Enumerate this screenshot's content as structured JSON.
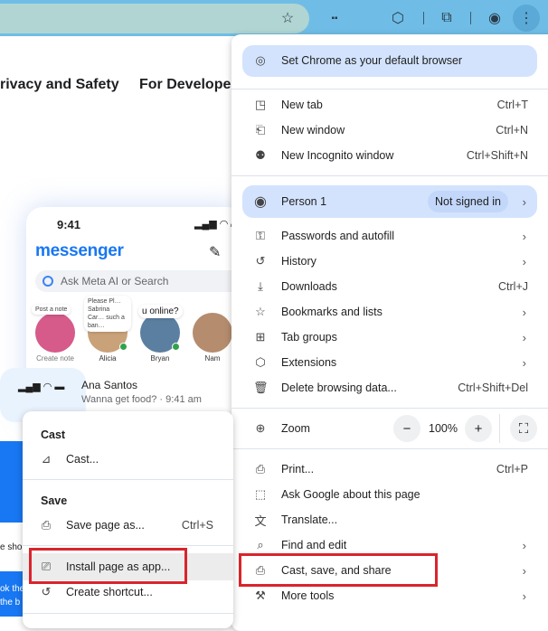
{
  "toolbar": {
    "icons": [
      "star-icon",
      "tab-search-icon",
      "extensions-icon",
      "reading-list-icon",
      "profile-icon",
      "more-icon"
    ]
  },
  "page": {
    "nav": [
      "rivacy and Safety",
      "For Developer"
    ],
    "phone": {
      "time": "9:41",
      "logo": "messenger",
      "search_placeholder": "Ask Meta AI or Search",
      "notes": [
        "Post a note",
        "Please Pl… Sabrina Car… such a ban…",
        "u online?"
      ],
      "contacts": [
        "Create note",
        "Alicia",
        "Bryan",
        "Nam"
      ],
      "chat_name": "Ana Santos",
      "chat_preview": "Wanna get food? · 9:41 am"
    },
    "fragments": [
      "e sho",
      "ok the",
      "the b"
    ]
  },
  "menu": {
    "default_browser": "Set Chrome as your default browser",
    "items_a": [
      {
        "label": "New tab",
        "shortcut": "Ctrl+T",
        "icon": "◳"
      },
      {
        "label": "New window",
        "shortcut": "Ctrl+N",
        "icon": "⎗"
      },
      {
        "label": "New Incognito window",
        "shortcut": "Ctrl+Shift+N",
        "icon": "⚉"
      }
    ],
    "person": {
      "label": "Person 1",
      "status": "Not signed in"
    },
    "items_b": [
      {
        "label": "Passwords and autofill",
        "shortcut": "",
        "icon": "⚿",
        "arrow": true
      },
      {
        "label": "History",
        "shortcut": "",
        "icon": "↺",
        "arrow": true
      },
      {
        "label": "Downloads",
        "shortcut": "Ctrl+J",
        "icon": "⤓"
      },
      {
        "label": "Bookmarks and lists",
        "shortcut": "",
        "icon": "☆",
        "arrow": true
      },
      {
        "label": "Tab groups",
        "shortcut": "",
        "icon": "⊞",
        "arrow": true
      },
      {
        "label": "Extensions",
        "shortcut": "",
        "icon": "⬡",
        "arrow": true
      },
      {
        "label": "Delete browsing data...",
        "shortcut": "Ctrl+Shift+Del",
        "icon": "🗑"
      }
    ],
    "zoom": {
      "label": "Zoom",
      "value": "100%",
      "minus": "−",
      "plus": "+"
    },
    "items_c": [
      {
        "label": "Print...",
        "shortcut": "Ctrl+P",
        "icon": "⎙"
      },
      {
        "label": "Ask Google about this page",
        "shortcut": "",
        "icon": "⬚"
      },
      {
        "label": "Translate...",
        "shortcut": "",
        "icon": "文"
      },
      {
        "label": "Find and edit",
        "shortcut": "",
        "icon": "⌕",
        "arrow": true
      },
      {
        "label": "Cast, save, and share",
        "shortcut": "",
        "icon": "⎙",
        "arrow": true
      },
      {
        "label": "More tools",
        "shortcut": "",
        "icon": "⚒",
        "arrow": true
      }
    ]
  },
  "submenu": {
    "cast_header": "Cast",
    "cast": "Cast...",
    "save_header": "Save",
    "save_page": "Save page as...",
    "save_shortcut": "Ctrl+S",
    "install": "Install page as app...",
    "shortcut": "Create shortcut..."
  },
  "highlight_color": "#d9242c"
}
